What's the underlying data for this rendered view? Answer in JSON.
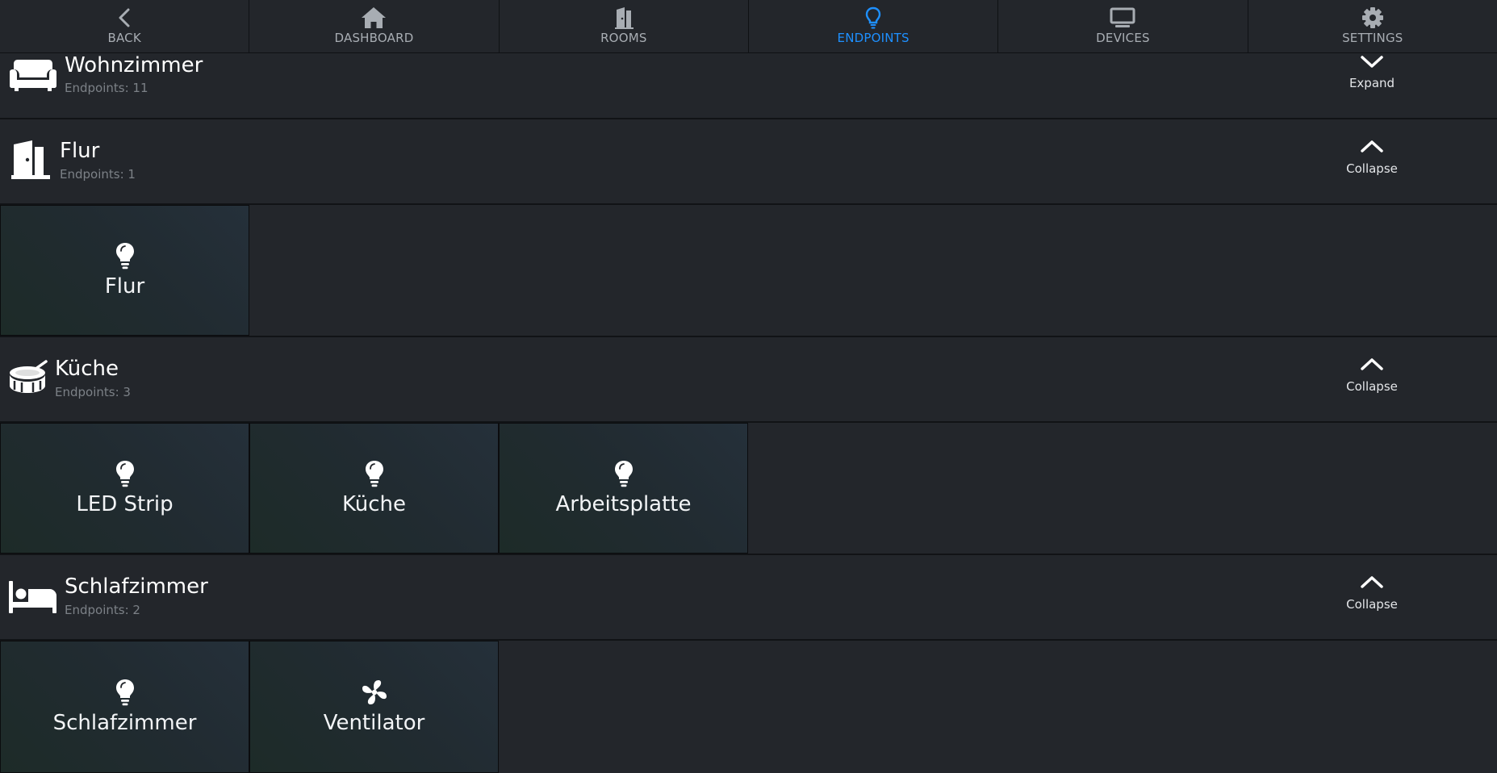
{
  "nav": [
    {
      "label": "BACK",
      "icon": "chevron-left-icon",
      "active": false
    },
    {
      "label": "DASHBOARD",
      "icon": "home-icon",
      "active": false
    },
    {
      "label": "ROOMS",
      "icon": "door-icon",
      "active": false
    },
    {
      "label": "ENDPOINTS",
      "icon": "lightbulb-icon",
      "active": true
    },
    {
      "label": "DEVICES",
      "icon": "monitor-icon",
      "active": false
    },
    {
      "label": "SETTINGS",
      "icon": "gear-icon",
      "active": false
    }
  ],
  "colors": {
    "accent": "#1e90ff",
    "background": "#23262b",
    "nav_text": "#a8adb3"
  },
  "rooms": [
    {
      "name": "Wohnzimmer",
      "count": "Endpoints: 11",
      "icon": "couch-icon",
      "toggle": "Expand",
      "toggle_icon": "chevron-down-icon",
      "endpoints": []
    },
    {
      "name": "Flur",
      "count": "Endpoints: 1",
      "icon": "door-open-icon",
      "toggle": "Collapse",
      "toggle_icon": "chevron-up-icon",
      "endpoints": [
        {
          "name": "Flur",
          "icon": "lightbulb-icon"
        }
      ]
    },
    {
      "name": "Küche",
      "count": "Endpoints: 3",
      "icon": "drum-icon",
      "toggle": "Collapse",
      "toggle_icon": "chevron-up-icon",
      "endpoints": [
        {
          "name": "LED Strip",
          "icon": "lightbulb-icon"
        },
        {
          "name": "Küche",
          "icon": "lightbulb-icon"
        },
        {
          "name": "Arbeitsplatte",
          "icon": "lightbulb-icon"
        }
      ]
    },
    {
      "name": "Schlafzimmer",
      "count": "Endpoints: 2",
      "icon": "bed-icon",
      "toggle": "Collapse",
      "toggle_icon": "chevron-up-icon",
      "endpoints": [
        {
          "name": "Schlafzimmer",
          "icon": "lightbulb-icon"
        },
        {
          "name": "Ventilator",
          "icon": "fan-icon"
        }
      ]
    }
  ]
}
